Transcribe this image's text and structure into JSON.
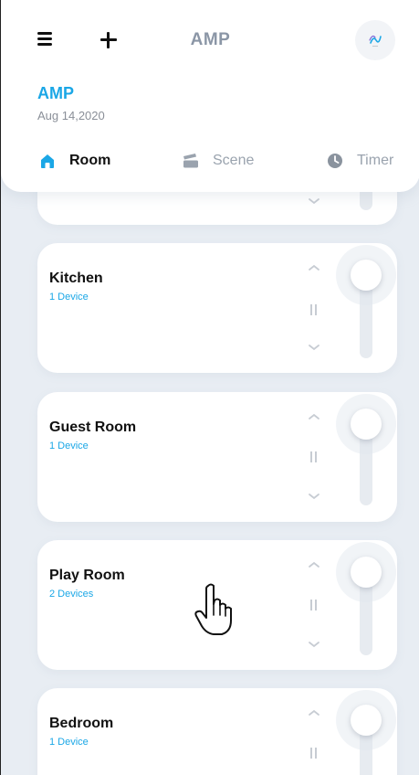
{
  "header": {
    "app_title": "AMP",
    "home_name": "AMP",
    "home_date": "Aug 14,2020",
    "icons": {
      "menu": "menu-icon",
      "add": "plus-icon",
      "logo": "amp-logo-icon"
    }
  },
  "tabs": [
    {
      "label": "Room",
      "icon": "home-icon",
      "active": true
    },
    {
      "label": "Scene",
      "icon": "scene-icon",
      "active": false
    },
    {
      "label": "Timer",
      "icon": "clock-icon",
      "active": false
    }
  ],
  "rooms": [
    {
      "name": "",
      "devices": ""
    },
    {
      "name": "Kitchen",
      "devices": "1 Device"
    },
    {
      "name": "Guest Room",
      "devices": "1 Device"
    },
    {
      "name": "Play Room",
      "devices": "2 Devices"
    },
    {
      "name": "Bedroom",
      "devices": "1 Device"
    }
  ],
  "colors": {
    "accent": "#1ba7e6",
    "background": "#e8edf3",
    "card": "#ffffff",
    "muted_text": "#9aa3ae"
  }
}
